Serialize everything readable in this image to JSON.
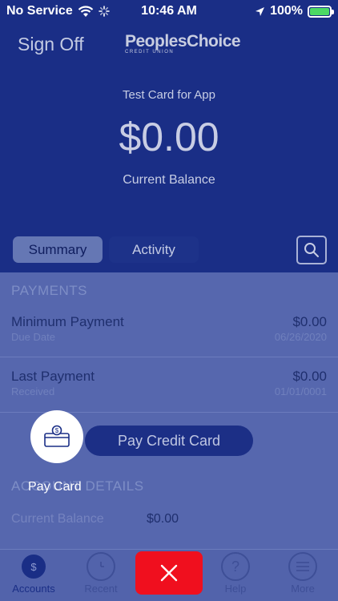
{
  "status_bar": {
    "carrier": "No Service",
    "time": "10:46 AM",
    "battery": "100%"
  },
  "header": {
    "sign_off": "Sign Off",
    "logo_main": "PeoplesChoice",
    "logo_sub": "CREDIT UNION",
    "card_name": "Test Card for App",
    "balance": "$0.00",
    "balance_label": "Current Balance"
  },
  "tabs": {
    "summary": "Summary",
    "activity": "Activity"
  },
  "payments": {
    "heading": "PAYMENTS",
    "minimum": {
      "title": "Minimum Payment",
      "sub": "Due Date",
      "amount": "$0.00",
      "date": "06/26/2020"
    },
    "last": {
      "title": "Last Payment",
      "sub": "Received",
      "amount": "$0.00",
      "date": "01/01/0001"
    }
  },
  "account_details": {
    "heading": "ACCOUNT DETAILS",
    "current_balance_label": "Current Balance",
    "current_balance_value": "$0.00"
  },
  "actions": {
    "pay_credit_card": "Pay Credit Card",
    "pay_card": "Pay Card"
  },
  "tabbar": {
    "accounts": "Accounts",
    "recent": "Recent",
    "help": "Help",
    "more": "More"
  },
  "colors": {
    "primary": "#1a2e86",
    "overlay": "#5667ae",
    "close": "#f00f1e"
  }
}
